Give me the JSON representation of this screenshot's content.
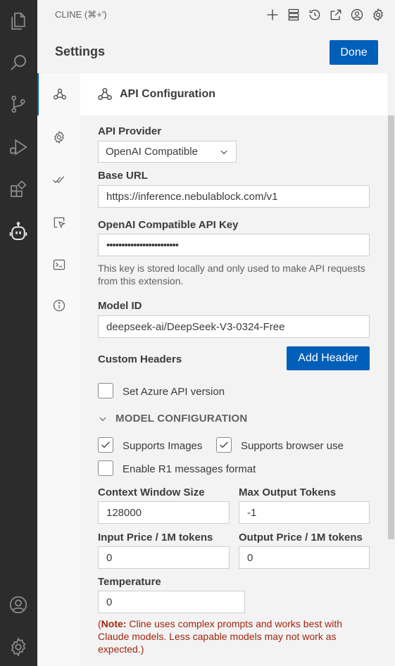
{
  "header": {
    "view_title": "CLINE (⌘+')",
    "settings_title": "Settings",
    "done_label": "Done"
  },
  "toolbar_icons": [
    "plus-icon",
    "server-icon",
    "history-icon",
    "popout-icon",
    "account-icon",
    "gear-icon"
  ],
  "activity_icons": [
    "explorer-icon",
    "search-icon",
    "source-control-icon",
    "run-debug-icon",
    "extensions-icon",
    "cline-icon",
    "account-icon",
    "gear-icon"
  ],
  "tabs": [
    "api-configuration",
    "general",
    "features",
    "browser",
    "terminal",
    "about"
  ],
  "section": {
    "title": "API Configuration"
  },
  "form": {
    "provider_label": "API Provider",
    "provider_value": "OpenAI Compatible",
    "base_url_label": "Base URL",
    "base_url_value": "https://inference.nebulablock.com/v1",
    "api_key_label": "OpenAI Compatible API Key",
    "api_key_value": "••••••••••••••••••••••••",
    "api_key_hint": "This key is stored locally and only used to make API requests from this extension.",
    "model_id_label": "Model ID",
    "model_id_value": "deepseek-ai/DeepSeek-V3-0324-Free",
    "custom_headers_label": "Custom Headers",
    "add_header_label": "Add Header",
    "azure_label": "Set Azure API version",
    "azure_checked": false
  },
  "model_config": {
    "heading": "MODEL CONFIGURATION",
    "supports_images_label": "Supports Images",
    "supports_images_checked": true,
    "supports_browser_label": "Supports browser use",
    "supports_browser_checked": true,
    "r1_label": "Enable R1 messages format",
    "r1_checked": false,
    "context_window_label": "Context Window Size",
    "context_window_value": "128000",
    "max_output_label": "Max Output Tokens",
    "max_output_value": "-1",
    "input_price_label": "Input Price / 1M tokens",
    "input_price_value": "0",
    "output_price_label": "Output Price / 1M tokens",
    "output_price_value": "0",
    "temperature_label": "Temperature",
    "temperature_value": "0",
    "note_open": "(",
    "note_bold": "Note:",
    "note_text": " Cline uses complex prompts and works best with Claude models. Less capable models may not work as expected.)"
  },
  "colors": {
    "accent": "#005fb8",
    "activity_bar": "#2c2c2c",
    "warning_text": "#a1260d"
  }
}
